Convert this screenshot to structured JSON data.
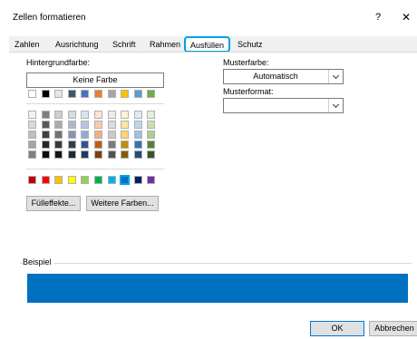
{
  "window": {
    "title": "Zellen formatieren",
    "help_glyph": "?",
    "close_glyph": "✕"
  },
  "tabs": [
    {
      "label": "Zahlen"
    },
    {
      "label": "Ausrichtung"
    },
    {
      "label": "Schrift"
    },
    {
      "label": "Rahmen"
    },
    {
      "label": "Ausfüllen",
      "active": true
    },
    {
      "label": "Schutz"
    }
  ],
  "fill": {
    "background_label": "Hintergrundfarbe:",
    "no_color_button": "Keine Farbe",
    "fill_effects_button": "Fülleffekte...",
    "more_colors_button": "Weitere Farben...",
    "selected_color": "#0070c0",
    "theme_row": [
      "#ffffff",
      "#000000",
      "#e7e6e6",
      "#44546a",
      "#4472c4",
      "#ed7d31",
      "#a5a5a5",
      "#ffc000",
      "#5b9bd5",
      "#70ad47"
    ],
    "tint_rows": [
      [
        "#f2f2f2",
        "#7f7f7f",
        "#d0cece",
        "#d6dce4",
        "#d9e2f3",
        "#fbe5d5",
        "#ededed",
        "#fff2cc",
        "#deebf6",
        "#e2efd9"
      ],
      [
        "#d8d8d8",
        "#595959",
        "#aeaaaa",
        "#adb9ca",
        "#b4c6e7",
        "#f7cbac",
        "#dbdbdb",
        "#fee599",
        "#bdd7ee",
        "#c5e0b3"
      ],
      [
        "#bfbfbf",
        "#3f3f3f",
        "#757070",
        "#8496b0",
        "#8eaadb",
        "#f4b083",
        "#c9c9c9",
        "#ffd965",
        "#9cc3e5",
        "#a8d08d"
      ],
      [
        "#a5a5a5",
        "#262626",
        "#3a3838",
        "#323f4f",
        "#2f5496",
        "#c45911",
        "#7b7b7b",
        "#bf8f00",
        "#2e75b5",
        "#538135"
      ],
      [
        "#7f7f7f",
        "#0c0c0c",
        "#171616",
        "#222a35",
        "#1f3864",
        "#833c0b",
        "#525252",
        "#7f6000",
        "#1e4e79",
        "#375623"
      ]
    ],
    "standard_row": [
      "#c00000",
      "#ff0000",
      "#ffc000",
      "#ffff00",
      "#92d050",
      "#00b050",
      "#00b0f0",
      "#0070c0",
      "#002060",
      "#7030a0"
    ]
  },
  "pattern": {
    "color_label": "Musterfarbe:",
    "color_value": "Automatisch",
    "style_label": "Musterformat:",
    "style_value": ""
  },
  "sample": {
    "label": "Beispiel",
    "color": "#0070c0"
  },
  "footer": {
    "ok": "OK",
    "cancel": "Abbrechen"
  }
}
